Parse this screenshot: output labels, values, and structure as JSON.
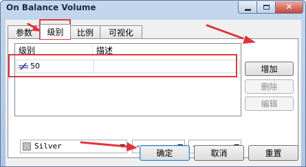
{
  "window": {
    "title": "On Balance Volume"
  },
  "tabs": [
    {
      "label": "参数",
      "active": false
    },
    {
      "label": "级别",
      "active": true
    },
    {
      "label": "比例",
      "active": false
    },
    {
      "label": "可视化",
      "active": false
    }
  ],
  "levels_table": {
    "columns": [
      "级别",
      "描述"
    ],
    "rows": [
      {
        "level": "50",
        "description": ""
      }
    ]
  },
  "side_buttons": {
    "add": "增加",
    "delete": "删除",
    "edit": "编辑"
  },
  "style": {
    "color_name": "Silver",
    "color_hex": "#C0C0C0",
    "line_style": "dashed",
    "line_width": "thin"
  },
  "bottom_buttons": {
    "ok": "确定",
    "cancel": "取消",
    "reset": "重置"
  },
  "annotation_color": "#e0353a"
}
